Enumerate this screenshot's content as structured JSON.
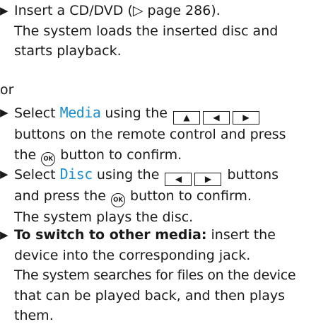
{
  "steps": [
    {
      "text_1": "Insert a CD/DVD (",
      "page_ref": "▷ page 286",
      "text_2": ").",
      "result_1": "The system loads the inserted disc and",
      "result_2": "starts playback."
    },
    {
      "separator": "or"
    },
    {
      "text_1": "Select ",
      "menu_term": "Media",
      "text_2": " using the",
      "keys": [
        "▲",
        "◀",
        "▶"
      ],
      "line_2": "buttons on the remote control and press",
      "line_3_a": "the ",
      "ok_label": "OK",
      "line_3_b": " button to confirm."
    },
    {
      "text_1": "Select ",
      "menu_term": "Disc",
      "text_2": " using the",
      "keys": [
        "◀",
        "▶"
      ],
      "text_3": " buttons",
      "line_2_a": "and press the ",
      "ok_label": "OK",
      "line_2_b": " button to confirm.",
      "result": "The system plays the disc."
    },
    {
      "bold_lead": "To switch to other media:",
      "text_1": " insert the",
      "line_2": "device into the corresponding jack.",
      "result_1": "The system searches for files on the device",
      "result_2": "that can be played back, and then plays",
      "result_3": "them."
    }
  ],
  "bullet_glyph": "▶"
}
